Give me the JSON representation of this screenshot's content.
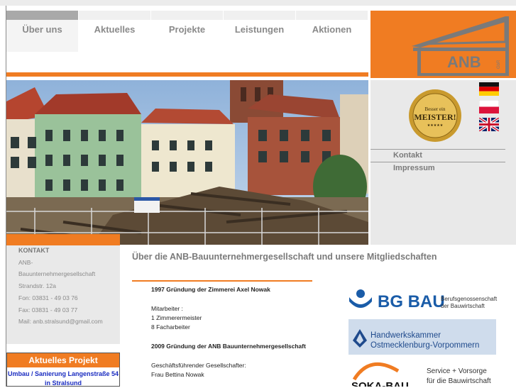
{
  "nav": {
    "items": [
      {
        "label": "Über uns",
        "active": true
      },
      {
        "label": "Aktuelles"
      },
      {
        "label": "Projekte"
      },
      {
        "label": "Leistungen"
      },
      {
        "label": "Aktionen"
      }
    ]
  },
  "logo": {
    "text": "ANB",
    "sub": "GbR"
  },
  "badge": {
    "top": "Besser ein",
    "main": "MEISTER!",
    "stars": "★★★★★"
  },
  "flags": [
    "german-flag",
    "polish-flag",
    "uk-flag"
  ],
  "side_links": {
    "kontakt": "Kontakt",
    "impressum": "Impressum"
  },
  "contact": {
    "title": "KONTAKT",
    "name1": "ANB-",
    "name2": "Bauunternehmergesellschaft",
    "street": "Strandstr. 12a",
    "phone": "Fon: 03831 - 49 03 76",
    "fax": "Fax: 03831 - 49 03 77",
    "mail": "Mail: anb.stralsund@gmail.com"
  },
  "project": {
    "heading": "Aktuelles Projekt",
    "line1": "Umbau / Sanierung Langenstraße 54",
    "line2": "in Stralsund"
  },
  "main": {
    "title": "Über die ANB-Bauunternehmergesellschaft und unsere Mitgliedschaften",
    "heading1": "1997 Gründung der Zimmerei Axel Nowak",
    "staff_label": "Mitarbeiter :",
    "staff1": "1 Zimmerermeister",
    "staff2": "8 Facharbeiter",
    "heading2": "2009 Gründung der ANB Bauunternehmergesellschaft",
    "ceo_label": "Geschäftsführender Gesellschafter:",
    "ceo": "Frau Bettina Nowak"
  },
  "partners": {
    "bgbau": {
      "name": "BG BAU",
      "line1": "Berufsgenossenschaft",
      "line2": "der Bauwirtschaft"
    },
    "hwk": {
      "line1": "Handwerkskammer",
      "line2": "Ostmecklenburg-Vorpommern"
    },
    "soka": {
      "name": "SOKA-BAU",
      "line1": "Service + Vorsorge",
      "line2": "für die Bauwirtschaft"
    }
  },
  "colors": {
    "accent": "#f07c22",
    "panel": "#e9e9e9",
    "link": "#1a2cc0"
  }
}
